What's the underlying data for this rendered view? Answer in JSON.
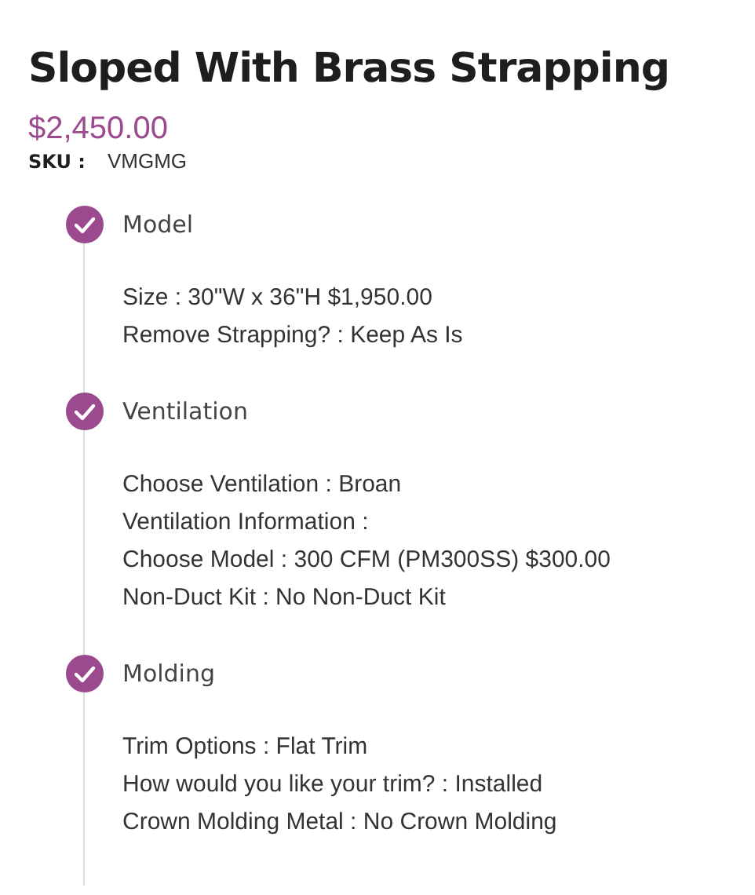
{
  "product": {
    "title": "Sloped With Brass Strapping",
    "price": "$2,450.00",
    "sku_label": "SKU :",
    "sku": "VMGMG"
  },
  "steps": [
    {
      "title": "Model",
      "completed": true,
      "lines": [
        "Size : 30\"W x 36\"H $1,950.00",
        "Remove Strapping? : Keep As Is"
      ]
    },
    {
      "title": "Ventilation",
      "completed": true,
      "lines": [
        "Choose Ventilation : Broan",
        "Ventilation Information :",
        "Choose Model : 300 CFM (PM300SS) $300.00",
        "Non-Duct Kit : No Non-Duct Kit"
      ]
    },
    {
      "title": "Molding",
      "completed": true,
      "lines": [
        "Trim Options : Flat Trim",
        "How would you like your trim? : Installed",
        "Crown Molding Metal : No Crown Molding"
      ]
    }
  ]
}
